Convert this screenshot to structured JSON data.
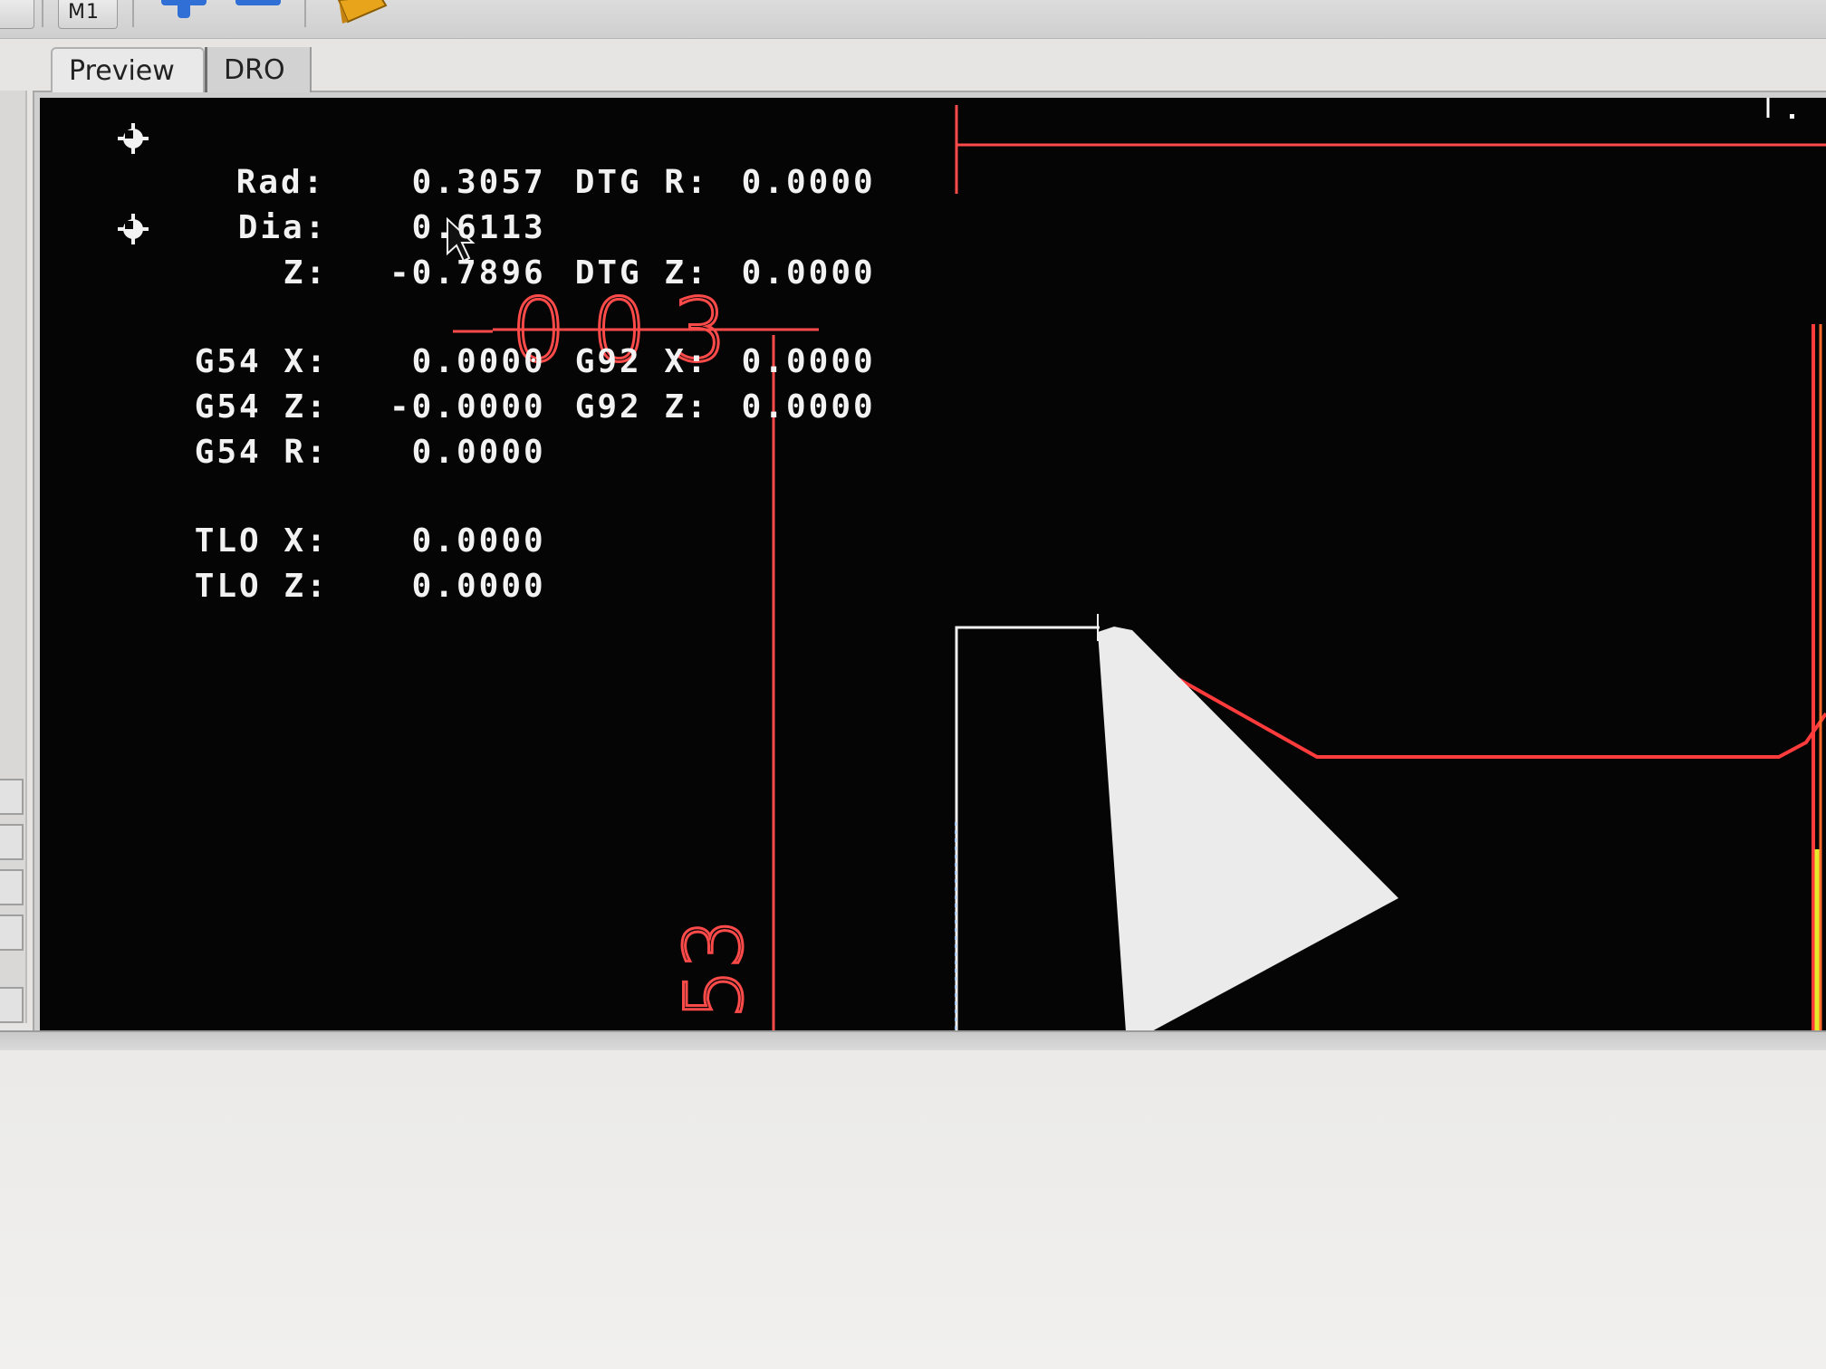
{
  "toolbar": {
    "m1_label": "M1"
  },
  "tabs": {
    "preview_label": "Preview",
    "dro_label": "DRO"
  },
  "dro": {
    "rad_label": "Rad:",
    "rad_value": "0.3057",
    "dia_label": "Dia:",
    "dia_value": "0.6113",
    "z_label": "Z:",
    "z_value": "-0.7896",
    "dtg_r_label": "DTG R:",
    "dtg_r_value": "0.0000",
    "dtg_z_label": "DTG Z:",
    "dtg_z_value": "0.0000",
    "g54_x_label": "G54 X:",
    "g54_x_value": "0.0000",
    "g54_z_label": "G54 Z:",
    "g54_z_value": "-0.0000",
    "g54_r_label": "G54 R:",
    "g54_r_value": "0.0000",
    "g92_x_label": "G92 X:",
    "g92_x_value": "0.0000",
    "g92_z_label": "G92 Z:",
    "g92_z_value": "0.0000",
    "tlo_x_label": "TLO X:",
    "tlo_x_value": "0.0000",
    "tlo_z_label": "TLO Z:",
    "tlo_z_value": "0.0000"
  },
  "preview": {
    "dimension_label_1": "003",
    "dimension_label_2": "53"
  },
  "colors": {
    "toolpath": "#ff3b3b",
    "tool": "#ebebeb",
    "background": "#050505",
    "dro_text": "#f2f2f2",
    "limit_yellow": "#e6e82a"
  }
}
